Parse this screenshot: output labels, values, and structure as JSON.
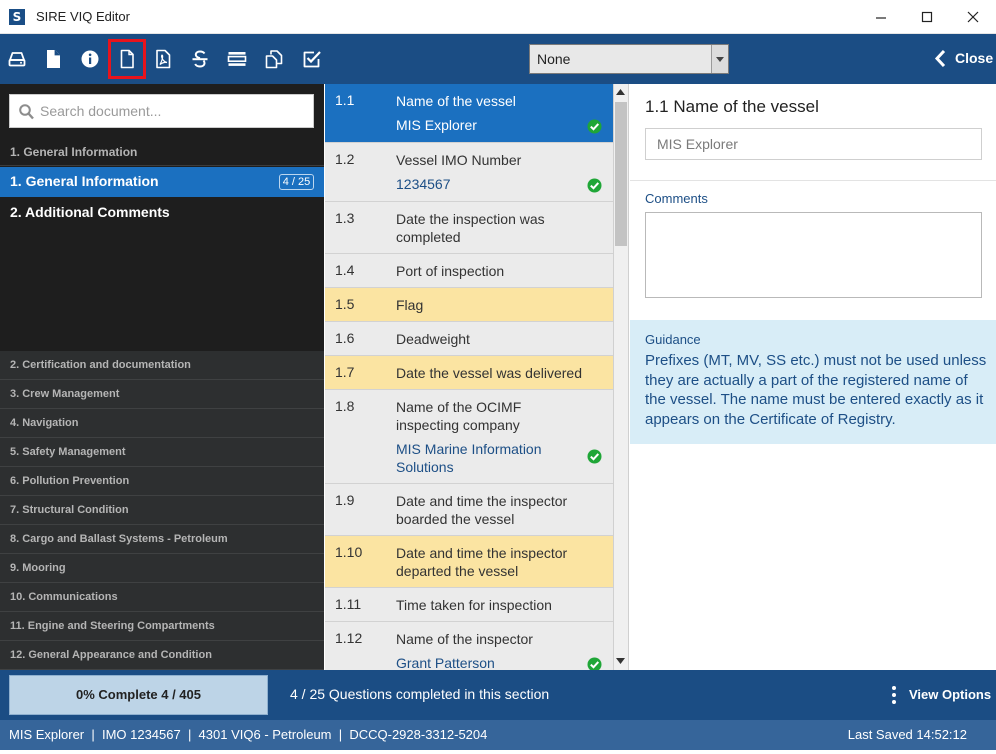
{
  "window": {
    "logo_letter": "S",
    "title": "SIRE VIQ Editor"
  },
  "toolbar": {
    "buttons": [
      {
        "icon": "drive-icon"
      },
      {
        "icon": "new-document-icon"
      },
      {
        "icon": "info-icon"
      },
      {
        "icon": "blank-document-icon",
        "active": true
      },
      {
        "icon": "pdf-icon"
      },
      {
        "icon": "strikethrough-icon"
      },
      {
        "icon": "list-icon"
      },
      {
        "icon": "copy-icon"
      },
      {
        "icon": "checkbox-icon"
      }
    ],
    "filter_value": "None",
    "close_label": "Close"
  },
  "sidebar": {
    "search_placeholder": "Search document...",
    "section_heading": "1. General Information",
    "sub_sections": [
      {
        "label": "1.  General Information",
        "badge": "4 / 25"
      },
      {
        "label": "2.  Additional Comments"
      }
    ],
    "categories": [
      "2. Certification and documentation",
      "3. Crew Management",
      "4. Navigation",
      "5. Safety Management",
      "6. Pollution Prevention",
      "7. Structural Condition",
      "8. Cargo and Ballast Systems - Petroleum",
      "9. Mooring",
      "10. Communications",
      "11. Engine and Steering Compartments",
      "12. General Appearance and Condition"
    ]
  },
  "questions": [
    {
      "num": "1.1",
      "text": "Name of the vessel",
      "answer": "MIS Explorer",
      "answered": true,
      "selected": true
    },
    {
      "num": "1.2",
      "text": "Vessel IMO Number",
      "answer": "1234567",
      "answered": true
    },
    {
      "num": "1.3",
      "text": "Date the inspection was completed"
    },
    {
      "num": "1.4",
      "text": "Port of inspection"
    },
    {
      "num": "1.5",
      "text": "Flag",
      "flagged": true
    },
    {
      "num": "1.6",
      "text": "Deadweight"
    },
    {
      "num": "1.7",
      "text": "Date the vessel was delivered",
      "flagged": true
    },
    {
      "num": "1.8",
      "text": "Name of the OCIMF inspecting company",
      "answer": "MIS Marine Information Solutions",
      "answered": true
    },
    {
      "num": "1.9",
      "text": "Date and time the inspector boarded the vessel"
    },
    {
      "num": "1.10",
      "text": "Date and time the inspector departed the vessel",
      "flagged": true
    },
    {
      "num": "1.11",
      "text": "Time taken for inspection"
    },
    {
      "num": "1.12",
      "text": "Name of the inspector",
      "answer": "Grant Patterson",
      "answered": true
    }
  ],
  "detail": {
    "title": "1.1 Name of the vessel",
    "answer_value": "MIS Explorer",
    "comments_label": "Comments",
    "comments_value": "",
    "guidance_label": "Guidance",
    "guidance_text": "Prefixes (MT, MV, SS etc.) must not be used unless they are actually a part of the registered name of the vessel.  The name must be entered exactly as it appears on the Certificate of Registry."
  },
  "progress": {
    "overall_fraction": 0,
    "overall_label": "0% Complete 4 / 405",
    "section_label": "4 / 25 Questions completed in this section",
    "view_options_label": "View Options"
  },
  "status": {
    "info": "MIS Explorer  |  IMO 1234567  |  4301 VIQ6 - Petroleum  |  DCCQ-2928-3312-5204",
    "last_saved": "Last Saved 14:52:12"
  },
  "colors": {
    "toolbar_bg": "#1b4d84",
    "selected_bg": "#1b70c0",
    "flag_bg": "#fbe4a2",
    "answered_check": "#1fa637",
    "active_button_outline": "#e8141c",
    "guidance_bg": "#d8edf7"
  }
}
